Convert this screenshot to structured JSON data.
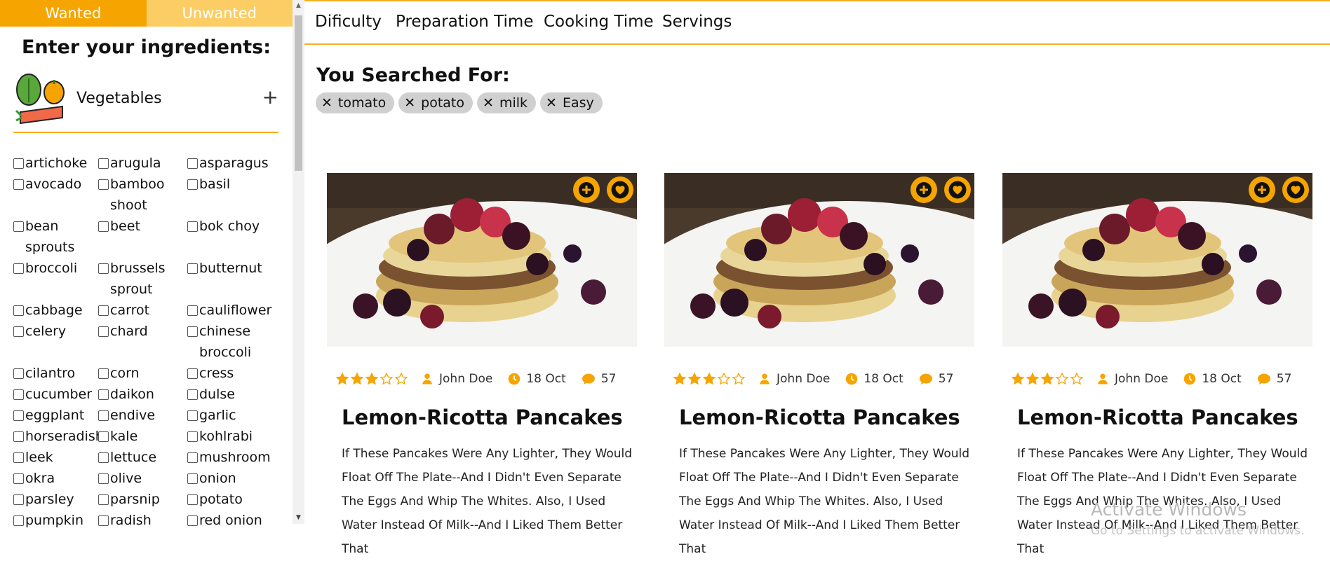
{
  "sidebar": {
    "tabs": [
      {
        "label": "Wanted"
      },
      {
        "label": "Unwanted"
      }
    ],
    "title": "Enter your ingredients:",
    "category": {
      "label": "Vegetables",
      "icon": "vegetables-icon",
      "toggle": "+"
    },
    "ingredients": [
      {
        "label": "artichoke"
      },
      {
        "label": "arugula"
      },
      {
        "label": "asparagus"
      },
      {
        "label": "avocado"
      },
      {
        "label": "bamboo shoot"
      },
      {
        "label": "basil"
      },
      {
        "label": "bean sprouts"
      },
      {
        "label": "beet"
      },
      {
        "label": "bok choy"
      },
      {
        "label": "broccoli"
      },
      {
        "label": "brussels sprout"
      },
      {
        "label": "butternut"
      },
      {
        "label": "cabbage"
      },
      {
        "label": "carrot"
      },
      {
        "label": "cauliflower"
      },
      {
        "label": "celery"
      },
      {
        "label": "chard"
      },
      {
        "label": "chinese broccoli"
      },
      {
        "label": "cilantro"
      },
      {
        "label": "corn"
      },
      {
        "label": "cress"
      },
      {
        "label": "cucumber"
      },
      {
        "label": "daikon"
      },
      {
        "label": "dulse"
      },
      {
        "label": "eggplant"
      },
      {
        "label": "endive"
      },
      {
        "label": "garlic"
      },
      {
        "label": "horseradish"
      },
      {
        "label": "kale"
      },
      {
        "label": "kohlrabi"
      },
      {
        "label": "leek"
      },
      {
        "label": "lettuce"
      },
      {
        "label": "mushroom"
      },
      {
        "label": "okra"
      },
      {
        "label": "olive"
      },
      {
        "label": "onion"
      },
      {
        "label": "parsley"
      },
      {
        "label": "parsnip"
      },
      {
        "label": "potato"
      },
      {
        "label": "pumpkin"
      },
      {
        "label": "radish"
      },
      {
        "label": "red onion"
      }
    ]
  },
  "filters": [
    {
      "label": "Dificulty"
    },
    {
      "label": "Preparation Time"
    },
    {
      "label": "Cooking Time"
    },
    {
      "label": "Servings"
    }
  ],
  "search": {
    "title": "You Searched For:",
    "remove_glyph": "✕",
    "chips": [
      {
        "label": "tomato"
      },
      {
        "label": "potato"
      },
      {
        "label": "milk"
      },
      {
        "label": "Easy"
      }
    ]
  },
  "cards": [
    {
      "title": "Lemon-Ricotta Pancakes",
      "author": "John Doe",
      "date": "18 Oct",
      "comments": "57",
      "rating": 3,
      "rating_max": 5,
      "description": "If These Pancakes Were Any Lighter, They Would Float Off The Plate--And I Didn't Even Separate The Eggs And Whip The Whites. Also, I Used Water Instead Of Milk--And I Liked Them Better That"
    },
    {
      "title": "Lemon-Ricotta Pancakes",
      "author": "John Doe",
      "date": "18 Oct",
      "comments": "57",
      "rating": 3,
      "rating_max": 5,
      "description": "If These Pancakes Were Any Lighter, They Would Float Off The Plate--And I Didn't Even Separate The Eggs And Whip The Whites. Also, I Used Water Instead Of Milk--And I Liked Them Better That"
    },
    {
      "title": "Lemon-Ricotta Pancakes",
      "author": "John Doe",
      "date": "18 Oct",
      "comments": "57",
      "rating": 3,
      "rating_max": 5,
      "description": "If These Pancakes Were Any Lighter, They Would Float Off The Plate--And I Didn't Even Separate The Eggs And Whip The Whites. Also, I Used Water Instead Of Milk--And I Liked Them Better That"
    }
  ],
  "watermark": {
    "line1": "Activate Windows",
    "line2": "Go to Settings to activate Windows."
  },
  "colors": {
    "accent": "#f6a400",
    "accent_light": "#fbcd64",
    "chip_bg": "#d0d0d0"
  }
}
